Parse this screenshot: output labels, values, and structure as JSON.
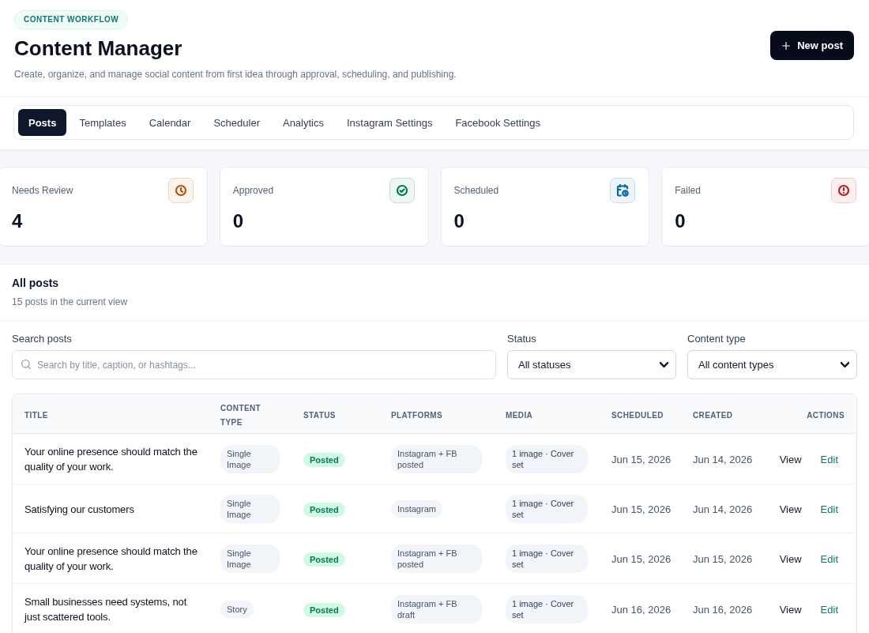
{
  "header": {
    "badge": "CONTENT WORKFLOW",
    "title": "Content Manager",
    "subtitle": "Create, organize, and manage social content from first idea through approval, scheduling, and publishing.",
    "new_post_button": "New post"
  },
  "tabs": [
    {
      "label": "Posts",
      "selected": true
    },
    {
      "label": "Templates",
      "selected": false
    },
    {
      "label": "Calendar",
      "selected": false
    },
    {
      "label": "Scheduler",
      "selected": false
    },
    {
      "label": "Analytics",
      "selected": false
    },
    {
      "label": "Instagram Settings",
      "selected": false
    },
    {
      "label": "Facebook Settings",
      "selected": false
    }
  ],
  "stats": [
    {
      "kind": "review",
      "label": "Needs Review",
      "value": "4",
      "color": "#b45309"
    },
    {
      "kind": "approved",
      "label": "Approved",
      "value": "0",
      "color": "#047857"
    },
    {
      "kind": "scheduled",
      "label": "Scheduled",
      "value": "0",
      "color": "#0369a1"
    },
    {
      "kind": "failed",
      "label": "Failed",
      "value": "0",
      "color": "#b91c1c"
    }
  ],
  "posts": {
    "title": "All posts",
    "subtitle": "15 posts in the current view",
    "search": {
      "label": "Search posts",
      "placeholder": "Search by title, caption, or hashtags..."
    },
    "status_filter": {
      "label": "Status",
      "value": "All statuses"
    },
    "type_filter": {
      "label": "Content type",
      "value": "All content types"
    },
    "table": {
      "columns": [
        "TITLE",
        "CONTENT TYPE",
        "STATUS",
        "PLATFORMS",
        "MEDIA",
        "SCHEDULED",
        "CREATED",
        "ACTIONS"
      ],
      "rows": [
        {
          "title": "Your online presence should match the quality of your work.",
          "content_type": "Single Image",
          "status": "Posted",
          "platforms": "Instagram + FB posted",
          "media": "1 image · Cover set",
          "scheduled": "Jun 15, 2026",
          "created": "Jun 14, 2026",
          "actions": [
            {
              "kind": "view",
              "label": "View"
            },
            {
              "kind": "edit",
              "label": "Edit"
            }
          ]
        },
        {
          "title": "Satisfying our customers",
          "content_type": "Single Image",
          "status": "Posted",
          "platforms": "Instagram",
          "media": "1 image · Cover set",
          "scheduled": "Jun 15, 2026",
          "created": "Jun 14, 2026",
          "actions": [
            {
              "kind": "view",
              "label": "View"
            },
            {
              "kind": "edit",
              "label": "Edit"
            }
          ]
        },
        {
          "title": "Your online presence should match the quality of your work.",
          "content_type": "Single Image",
          "status": "Posted",
          "platforms": "Instagram + FB posted",
          "media": "1 image · Cover set",
          "scheduled": "Jun 15, 2026",
          "created": "Jun 15, 2026",
          "actions": [
            {
              "kind": "view",
              "label": "View"
            },
            {
              "kind": "edit",
              "label": "Edit"
            }
          ]
        },
        {
          "title": "Small businesses need systems, not just scattered tools.",
          "content_type": "Story",
          "status": "Posted",
          "platforms": "Instagram + FB draft",
          "media": "1 image · Cover set",
          "scheduled": "Jun 16, 2026",
          "created": "Jun 16, 2026",
          "actions": [
            {
              "kind": "view",
              "label": "View"
            },
            {
              "kind": "edit",
              "label": "Edit"
            }
          ]
        }
      ]
    }
  }
}
